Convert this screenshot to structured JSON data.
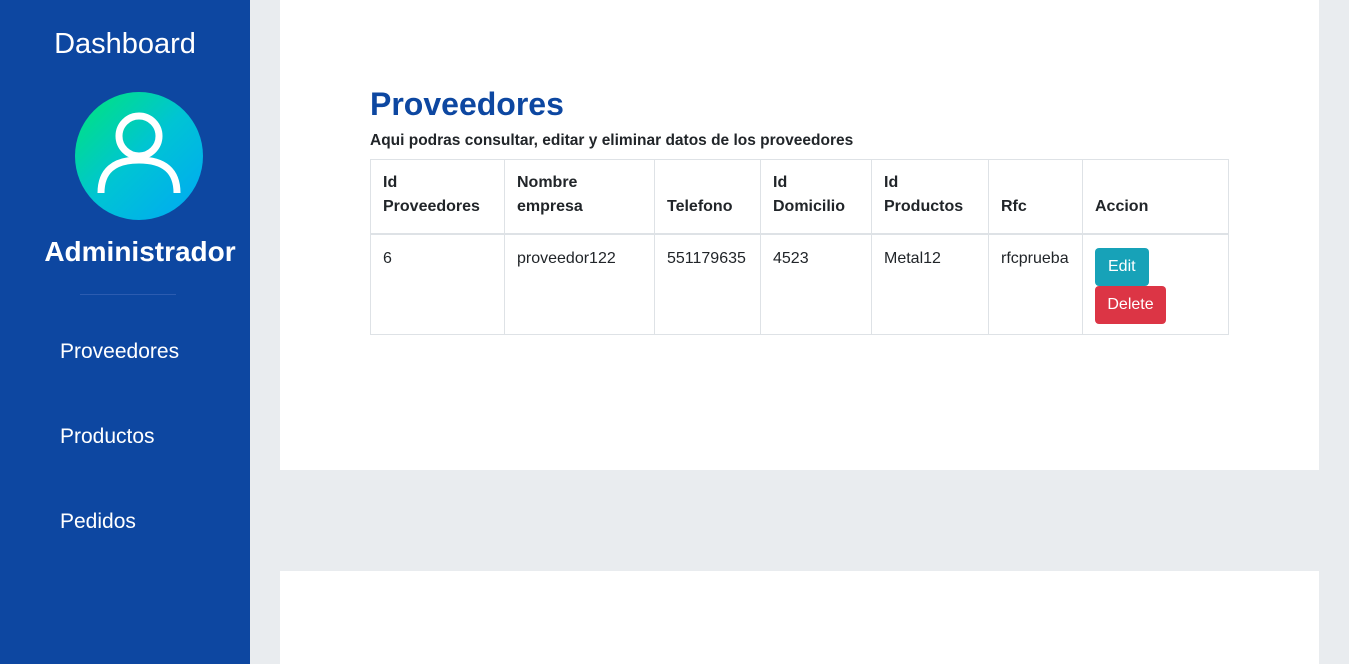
{
  "sidebar": {
    "title": "Dashboard",
    "avatar_icon": "user-icon",
    "role": "Administrador",
    "items": [
      {
        "label": "Proveedores"
      },
      {
        "label": "Productos"
      },
      {
        "label": "Pedidos"
      }
    ]
  },
  "main": {
    "title": "Proveedores",
    "subtitle": "Aqui podras consultar, editar y eliminar datos de los proveedores",
    "table": {
      "headers": [
        [
          "Id",
          "Proveedores"
        ],
        [
          "Nombre",
          "empresa"
        ],
        [
          "Telefono"
        ],
        [
          "Id",
          "Domicilio"
        ],
        [
          "Id",
          "Productos"
        ],
        [
          "Rfc"
        ],
        [
          "Accion"
        ]
      ],
      "rows": [
        {
          "id": "6",
          "nombre": "proveedor122",
          "telefono": "551179635",
          "domicilio": "4523",
          "productos": "Metal12",
          "rfc": "rfcprueba",
          "edit_label": "Edit",
          "delete_label": "Delete"
        }
      ]
    }
  },
  "colors": {
    "sidebar_bg": "#0d47a1",
    "title": "#0d47a1",
    "edit_button": "#17a2b8",
    "delete_button": "#dc3545",
    "page_bg": "#e9ecef"
  }
}
